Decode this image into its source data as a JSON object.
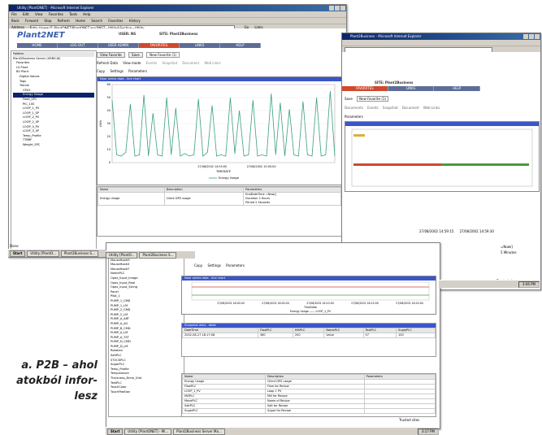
{
  "window_back": {
    "title": "Utility [PlantONET] - Microsoft Internet Explorer",
    "menu": [
      "File",
      "Edit",
      "View",
      "Favorites",
      "Tools",
      "Help"
    ],
    "toolbar": [
      "Back",
      "Forward",
      "Stop",
      "Refresh",
      "Home",
      "Search",
      "Favorites",
      "History"
    ],
    "address_label": "Address",
    "address_value": "http://www.f1.PlantONET/PlantONET.asp?INST=Utility&Section=Utility",
    "go_label": "Go",
    "links_label": "Links"
  },
  "app": {
    "logo": "Plant2NET",
    "user_label": "USER: NS",
    "site_label": "SITE: Plant2Business",
    "nav": [
      "HOME",
      "LOG OUT",
      "USER ADMIN",
      "FAVORITES",
      "LINKS",
      "HELP"
    ],
    "nav_active": 3
  },
  "tree": {
    "title": "Folders",
    "items": [
      "Plant2Business Server (URBS-W)",
      "Favorites",
      "LS Plant",
      "BV Plant",
      "Digital Values",
      "Tags",
      "Trends",
      "CPU2",
      "Energy Usage",
      "Feed_SPC",
      "PIC_100",
      "LOOP_1_PV",
      "LOOP_1_SP",
      "LOOP_2_PV",
      "LOOP_2_SP",
      "LOOP_3_PV",
      "LOOP_3_SP",
      "Temp_Profile",
      "TTBRF",
      "Weight_SPC"
    ],
    "selected_index": 8
  },
  "view_tabs": [
    "View Favorite",
    "Save",
    "New Favorite (1)"
  ],
  "action_bar": [
    "Refresh Data",
    "View mode",
    "Events",
    "Snapshot",
    "Document",
    "Web Links"
  ],
  "sub_tabs": [
    "Copy",
    "Settings",
    "Parameters"
  ],
  "main_chart": {
    "header": "Near series data - line chart",
    "ylabel": "kWh",
    "xlabel": "TIMEDATE",
    "xticks": [
      "27/08/2002 14:55:00",
      "27/08/2002 15:00:00"
    ],
    "legend": "Energy Usage"
  },
  "chart_data": {
    "type": "line",
    "title": "",
    "xlabel": "TIMEDATE",
    "ylabel": "kWh",
    "ylim": [
      0,
      60
    ],
    "yticks": [
      0,
      10,
      20,
      30,
      40,
      50,
      60
    ],
    "series": [
      {
        "name": "Energy Usage",
        "color": "#3aa07e",
        "values": [
          48,
          6,
          5,
          8,
          45,
          5,
          6,
          52,
          5,
          38,
          6,
          5,
          50,
          6,
          42,
          5,
          7,
          5,
          6,
          49,
          5,
          8,
          44,
          5,
          6,
          5,
          50,
          7,
          40,
          5,
          6,
          48,
          5,
          6,
          5,
          53,
          6,
          46,
          5,
          41,
          6,
          5,
          47,
          6,
          5,
          50,
          5,
          6,
          55,
          5
        ]
      }
    ]
  },
  "params_table": {
    "headers": [
      "Name",
      "Description",
      "Parameters"
    ],
    "rows": [
      {
        "name": "Energy Usage",
        "desc": "Client DPS usage",
        "params": [
          "EndDateTime =Now()",
          "Duration 2 Hours",
          "Period 2 Seconds"
        ]
      }
    ]
  },
  "window_right": {
    "title": "Plant2Business - Microsoft Internet Explorer",
    "site_label": "SITE: Plant2Business",
    "nav": [
      "FAVORITES",
      "LINKS",
      "HELP"
    ],
    "tabs": [
      "Save",
      "New Favorite (1)"
    ],
    "actions": [
      "Documents",
      "Events",
      "Snapshot",
      "Document",
      "Web Links"
    ],
    "sub": [
      "Parameters"
    ],
    "times": [
      "27/08/2002 14:59:15",
      "27/08/2002 14:59:30"
    ],
    "cell_now": "=Now()",
    "cell_min": "5 Minutes",
    "status": "Trusted sites"
  },
  "window_front": {
    "tabs": [
      "Copy",
      "Settings",
      "Parameters"
    ],
    "chart_header": "Near series data - line chart",
    "xticks": [
      "27/08/2002 18:00:00",
      "27/08/2002 18:05:00",
      "27/08/2002 18:10:00",
      "27/08/2002 18:15:00",
      "27/08/2002 18:20:00"
    ],
    "xlabel": "TimeDate",
    "legend": "Energy Usage —— LOOP_1_PV",
    "grid_header": "Snapshot data - table",
    "grid_headers": [
      "DateTime",
      "FlowPLC",
      "HiltPLC",
      "NamePLC",
      "TestPLC",
      "SugarPLC"
    ],
    "grid_row": [
      "2002-08-27 18:17:08",
      "360",
      "200",
      "Value",
      "57",
      "100"
    ],
    "tree_items": [
      "MIX_RUNNING",
      "MouseHookH",
      "MouseHookX",
      "MouseHookY",
      "NamePLC",
      "Opex_Input_Image",
      "Opex_Input_Real",
      "Opex_Input_String",
      "Panel",
      "Pilot_1",
      "PUMP_1_CMD",
      "PUMP_1_LM",
      "PUMP_2_CMD",
      "PUMP_2_LM",
      "PUMP_A_ART",
      "PUMP_A_AO",
      "PUMP_B_CMD",
      "PUMP_A_LM",
      "PUMP_A_TST",
      "PUMP_D_CMD",
      "PUMP_D_LM",
      "Rotation",
      "SaltPLC",
      "STOCKPLC",
      "SugarPLC",
      "Temp_Profile",
      "Temperature",
      "Thickness_Brine_Grid",
      "TestPLC",
      "TouchColor",
      "TouchPosition"
    ],
    "desc_table": {
      "headers": [
        "Name",
        "Description",
        "Parameters"
      ],
      "rows": [
        [
          "Energy Usage",
          "Client DPS usage"
        ],
        [
          "FlowPLC",
          "Flow for Recipe"
        ],
        [
          "LOOP_1_PV",
          "Loop 1 PV"
        ],
        [
          "MillPLC",
          "Mill for Recipe"
        ],
        [
          "MovePLC",
          "Name of Recipe"
        ],
        [
          "SaltPLC",
          "Salt for Recipe"
        ],
        [
          "SugarPLC",
          "Sugar for Recipe"
        ]
      ]
    },
    "status": "Trusted sites"
  },
  "taskbars": {
    "top": {
      "start": "Start",
      "tasks": [
        "Utility [PlantO...",
        "Plant2Business S..."
      ],
      "clock": "3:04 PM",
      "status": "Done"
    },
    "right": {
      "clock": "3:06 PM"
    },
    "bottom": {
      "start": "Start",
      "tasks": [
        "Utility [PlantONET] - Mi...",
        "Plant2Business Server Ma..."
      ],
      "clock": "3:17 PM"
    },
    "mid": {
      "start": "Start",
      "tasks": [
        "Utility [PlantO...",
        "Plant2Business S..."
      ]
    }
  },
  "caption": {
    "lines": [
      "a. P2B – ahol",
      "atokból infor-",
      "lesz"
    ]
  }
}
